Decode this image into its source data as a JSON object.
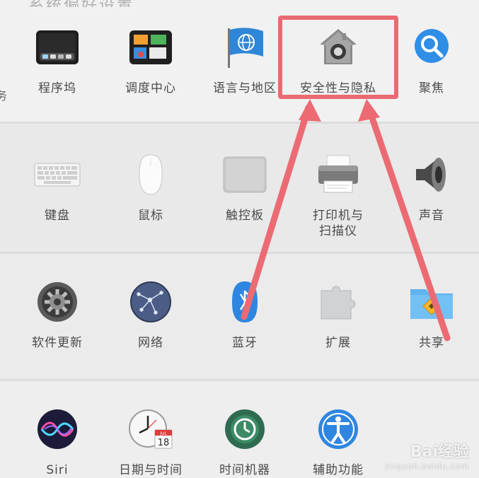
{
  "header": {
    "partial_title": "系统偏好设置"
  },
  "edge_fragment": "务",
  "rows": [
    {
      "items": [
        {
          "label": "程序坞",
          "icon": "dock-icon"
        },
        {
          "label": "调度中心",
          "icon": "mission-control-icon"
        },
        {
          "label": "语言与地区",
          "icon": "language-region-flag-icon"
        },
        {
          "label": "安全性与隐私",
          "icon": "security-privacy-house-icon",
          "highlighted": true
        },
        {
          "label": "聚焦",
          "icon": "spotlight-magnifier-icon"
        }
      ]
    },
    {
      "items": [
        {
          "label": "键盘",
          "icon": "keyboard-icon"
        },
        {
          "label": "鼠标",
          "icon": "mouse-icon"
        },
        {
          "label": "触控板",
          "icon": "trackpad-icon"
        },
        {
          "label": "打印机与\n扫描仪",
          "icon": "printer-icon"
        },
        {
          "label": "声音",
          "icon": "speaker-icon"
        }
      ]
    },
    {
      "items": [
        {
          "label": "软件更新",
          "icon": "gear-update-icon"
        },
        {
          "label": "网络",
          "icon": "network-globe-icon"
        },
        {
          "label": "蓝牙",
          "icon": "bluetooth-icon"
        },
        {
          "label": "扩展",
          "icon": "puzzle-extension-icon"
        },
        {
          "label": "共享",
          "icon": "shared-folder-icon"
        }
      ]
    },
    {
      "items": [
        {
          "label": "Siri",
          "icon": "siri-icon"
        },
        {
          "label": "日期与时间",
          "icon": "clock-calendar-icon",
          "calendar_month": "JUL",
          "calendar_day": "18"
        },
        {
          "label": "时间机器",
          "icon": "time-machine-icon"
        },
        {
          "label": "辅助功能",
          "icon": "accessibility-icon"
        }
      ]
    }
  ],
  "annotation": {
    "highlight_color": "#e96a73",
    "arrow_color": "#ec6b73"
  },
  "watermark": {
    "text": "Bai经验",
    "subtext": "jingyan.baidu.com"
  }
}
